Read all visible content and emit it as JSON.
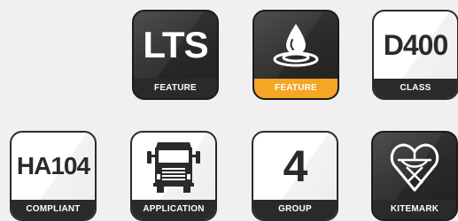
{
  "badges": [
    {
      "name": "lts",
      "main_text": "LTS",
      "label": "FEATURE"
    },
    {
      "name": "water",
      "icon": "water-drop-icon",
      "label": "FEATURE"
    },
    {
      "name": "d400",
      "main_text": "D400",
      "label": "CLASS"
    },
    {
      "name": "ha104",
      "main_text": "HA104",
      "label": "COMPLIANT"
    },
    {
      "name": "truck",
      "icon": "truck-icon",
      "label": "APPLICATION"
    },
    {
      "name": "group",
      "main_text": "4",
      "label": "GROUP"
    },
    {
      "name": "kitemark",
      "icon": "kitemark-icon",
      "label": "KITEMARK"
    }
  ],
  "colors": {
    "dark_badge": "#2a2a2a",
    "accent_label": "#f5a623",
    "background": "#f0f0f0"
  }
}
